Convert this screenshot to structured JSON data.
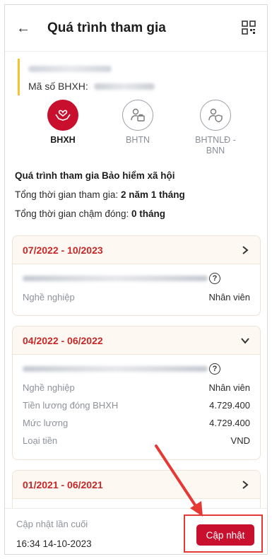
{
  "header": {
    "title": "Quá trình tham gia",
    "back_icon": "arrow-left-icon",
    "qr_icon": "qr-code-icon"
  },
  "user": {
    "bhxh_label": "Mã số BHXH:"
  },
  "tabs": [
    {
      "label": "BHXH",
      "icon": "hands-heart-icon",
      "active": true
    },
    {
      "label": "BHTN",
      "icon": "person-briefcase-icon",
      "active": false
    },
    {
      "label": "BHTNLĐ -BNN",
      "icon": "person-shield-icon",
      "active": false
    }
  ],
  "summary": {
    "heading": "Quá trình tham gia Bảo hiểm xã hội",
    "total_label": "Tổng thời gian tham gia:",
    "total_value": "2 năm 1 tháng",
    "late_label": "Tổng thời gian chậm đóng:",
    "late_value": "0 tháng"
  },
  "cards": [
    {
      "period": "07/2022 - 10/2023",
      "expanded": false,
      "rows": [
        {
          "k": "Nghề nghiệp",
          "v": "Nhân viên"
        }
      ]
    },
    {
      "period": "04/2022 - 06/2022",
      "expanded": true,
      "rows": [
        {
          "k": "Nghề nghiệp",
          "v": "Nhân viên"
        },
        {
          "k": "Tiền lương đóng BHXH",
          "v": "4.729.400"
        },
        {
          "k": "Mức lương",
          "v": "4.729.400"
        },
        {
          "k": "Loại tiền",
          "v": "VND"
        }
      ]
    },
    {
      "period": "01/2021 - 06/2021",
      "expanded": false,
      "rows": []
    }
  ],
  "footer": {
    "last_update_label": "Cập nhật lần cuối",
    "last_update_time": "16:34 14-10-2023",
    "update_button": "Cập nhật"
  },
  "colors": {
    "accent": "#c8102e",
    "period": "#c62828",
    "highlight": "#e53935",
    "user_bar": "#f4c430"
  }
}
